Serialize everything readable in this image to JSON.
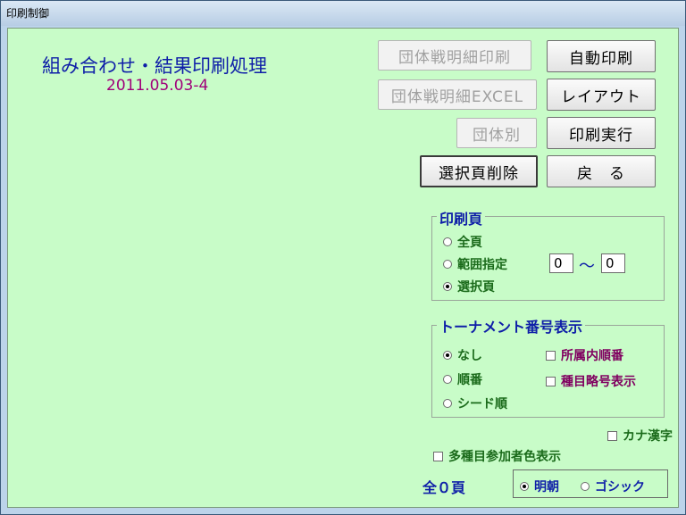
{
  "window": {
    "title": "印刷制御"
  },
  "header": {
    "heading": "組み合わせ・結果印刷処理",
    "version": "2011.05.03-4"
  },
  "buttons": {
    "team_detail_print": "団体戦明細印刷",
    "team_detail_excel": "団体戦明細EXCEL",
    "by_team": "団体別",
    "delete_selected_page": "選択頁削除",
    "auto_print": "自動印刷",
    "layout": "レイアウト",
    "print_execute": "印刷実行",
    "back": "戻　る"
  },
  "print_pages": {
    "legend": "印刷頁",
    "options": [
      "全頁",
      "範囲指定",
      "選択頁"
    ],
    "selected": "選択頁",
    "range_from": "0",
    "range_tilde": "〜",
    "range_to": "0"
  },
  "tournament_number": {
    "legend": "トーナメント番号表示",
    "options": [
      "なし",
      "順番",
      "シード順"
    ],
    "selected": "なし",
    "checkboxes": [
      "所属内順番",
      "種目略号表示"
    ]
  },
  "kana_kanji": {
    "label": "カナ漢字",
    "checked": false
  },
  "multi_event_color": {
    "label": "多種目参加者色表示",
    "checked": false
  },
  "total_pages": "全０頁",
  "font": {
    "options": [
      "明朝",
      "ゴシック"
    ],
    "selected": "明朝"
  }
}
